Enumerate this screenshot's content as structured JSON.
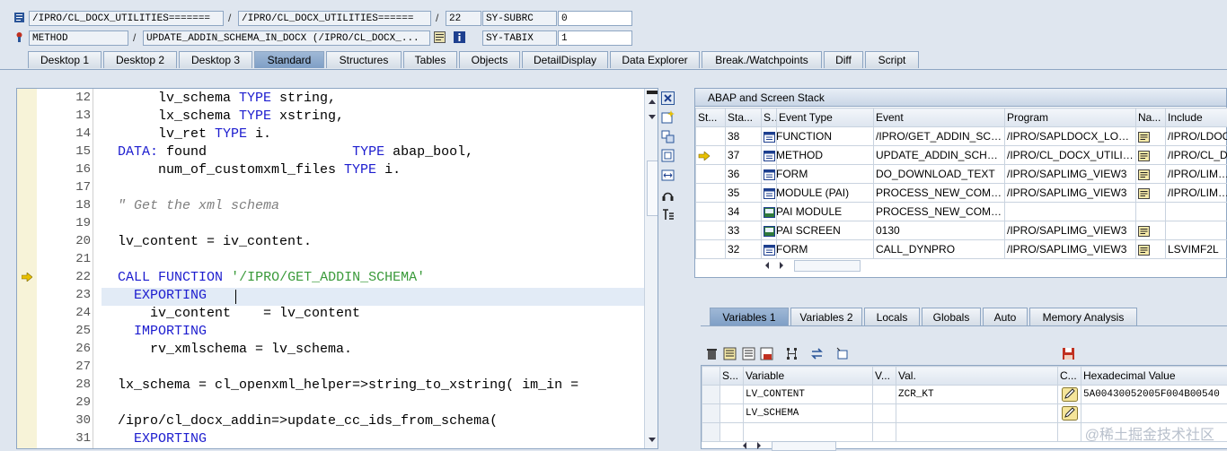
{
  "header": {
    "row1": {
      "program": "/IPRO/CL_DOCX_UTILITIES=======",
      "include": "/IPRO/CL_DOCX_UTILITIES======",
      "line": "22",
      "sy_label": "SY-SUBRC",
      "sy_value": "0"
    },
    "row2": {
      "event_type": "METHOD",
      "event": "UPDATE_ADDIN_SCHEMA_IN_DOCX (/IPRO/CL_DOCX_...",
      "sy_label": "SY-TABIX",
      "sy_value": "1"
    },
    "separator": "/"
  },
  "tabs": [
    {
      "label": "Desktop 1"
    },
    {
      "label": "Desktop 2"
    },
    {
      "label": "Desktop 3"
    },
    {
      "label": "Standard"
    },
    {
      "label": "Structures"
    },
    {
      "label": "Tables"
    },
    {
      "label": "Objects"
    },
    {
      "label": "DetailDisplay"
    },
    {
      "label": "Data Explorer"
    },
    {
      "label": "Break./Watchpoints"
    },
    {
      "label": "Diff"
    },
    {
      "label": "Script"
    }
  ],
  "code": {
    "lines": [
      {
        "n": "12",
        "parts": [
          [
            "",
            "       lv_schema "
          ],
          [
            "kw",
            "TYPE"
          ],
          [
            "",
            " string,"
          ]
        ]
      },
      {
        "n": "13",
        "parts": [
          [
            "",
            "       lx_schema "
          ],
          [
            "kw",
            "TYPE"
          ],
          [
            "",
            " xstring,"
          ]
        ]
      },
      {
        "n": "14",
        "parts": [
          [
            "",
            "       lv_ret "
          ],
          [
            "kw",
            "TYPE"
          ],
          [
            "",
            " i."
          ]
        ]
      },
      {
        "n": "15",
        "parts": [
          [
            "",
            "  "
          ],
          [
            "kw",
            "DATA:"
          ],
          [
            "",
            " found                  "
          ],
          [
            "kw",
            "TYPE"
          ],
          [
            "",
            " abap_bool,"
          ]
        ]
      },
      {
        "n": "16",
        "parts": [
          [
            "",
            "       num_of_customxml_files "
          ],
          [
            "kw",
            "TYPE"
          ],
          [
            "",
            " i."
          ]
        ]
      },
      {
        "n": "17",
        "parts": [
          [
            "",
            ""
          ]
        ]
      },
      {
        "n": "18",
        "parts": [
          [
            "",
            "  "
          ],
          [
            "cm",
            "\" Get the xml schema"
          ]
        ]
      },
      {
        "n": "19",
        "parts": [
          [
            "",
            ""
          ]
        ]
      },
      {
        "n": "20",
        "parts": [
          [
            "",
            "  lv_content = iv_content."
          ]
        ]
      },
      {
        "n": "21",
        "parts": [
          [
            "",
            ""
          ]
        ]
      },
      {
        "n": "22",
        "parts": [
          [
            "",
            "  "
          ],
          [
            "kw",
            "CALL FUNCTION"
          ],
          [
            "",
            " "
          ],
          [
            "str",
            "'/IPRO/GET_ADDIN_SCHEMA'"
          ]
        ]
      },
      {
        "n": "23",
        "parts": [
          [
            "",
            "    "
          ],
          [
            "kw",
            "EXPORTING"
          ]
        ]
      },
      {
        "n": "24",
        "parts": [
          [
            "",
            "      iv_content    = lv_content"
          ]
        ]
      },
      {
        "n": "25",
        "parts": [
          [
            "",
            "    "
          ],
          [
            "kw",
            "IMPORTING"
          ]
        ]
      },
      {
        "n": "26",
        "parts": [
          [
            "",
            "      rv_xmlschema = lv_schema."
          ]
        ]
      },
      {
        "n": "27",
        "parts": [
          [
            "",
            ""
          ]
        ]
      },
      {
        "n": "28",
        "parts": [
          [
            "",
            "  lx_schema = cl_openxml_helper=>string_to_xstring( im_in ="
          ]
        ]
      },
      {
        "n": "29",
        "parts": [
          [
            "",
            ""
          ]
        ]
      },
      {
        "n": "30",
        "parts": [
          [
            "",
            "  /ipro/cl_docx_addin=>update_cc_ids_from_schema("
          ]
        ]
      },
      {
        "n": "31",
        "parts": [
          [
            "",
            "    "
          ],
          [
            "kw",
            "EXPORTING"
          ]
        ]
      }
    ]
  },
  "stack": {
    "title": "ABAP and Screen Stack",
    "columns": [
      "St...",
      "Sta...",
      "S...",
      "Event Type",
      "Event",
      "Program",
      "Na...",
      "Include"
    ],
    "rows": [
      {
        "level": "38",
        "type": "FUNCTION",
        "event": "/IPRO/GET_ADDIN_SCH...",
        "program": "/IPRO/SAPLDOCX_LOGIC",
        "nav": true,
        "include": "/IPRO/LDOC"
      },
      {
        "level": "37",
        "type": "METHOD",
        "event": "UPDATE_ADDIN_SCHEM...",
        "program": "/IPRO/CL_DOCX_UTILITI...",
        "nav": true,
        "include": "/IPRO/CL_D",
        "current": true
      },
      {
        "level": "36",
        "type": "FORM",
        "event": "DO_DOWNLOAD_TEXT",
        "program": "/IPRO/SAPLIMG_VIEW3",
        "nav": true,
        "include": "/IPRO/LIMG_"
      },
      {
        "level": "35",
        "type": "MODULE (PAI)",
        "event": "PROCESS_NEW_COMMA...",
        "program": "/IPRO/SAPLIMG_VIEW3",
        "nav": true,
        "include": "/IPRO/LIMG_"
      },
      {
        "level": "34",
        "type": "PAI MODULE",
        "event": "PROCESS_NEW_COMMA...",
        "program": "",
        "nav": false,
        "include": ""
      },
      {
        "level": "33",
        "type": "PAI SCREEN",
        "event": "0130",
        "program": "/IPRO/SAPLIMG_VIEW3",
        "nav": true,
        "include": ""
      },
      {
        "level": "32",
        "type": "FORM",
        "event": "CALL_DYNPRO",
        "program": "/IPRO/SAPLIMG_VIEW3",
        "nav": true,
        "include": "LSVIMF2L"
      }
    ]
  },
  "var_tabs": [
    {
      "label": "Variables 1"
    },
    {
      "label": "Variables 2"
    },
    {
      "label": "Locals"
    },
    {
      "label": "Globals"
    },
    {
      "label": "Auto"
    },
    {
      "label": "Memory Analysis"
    }
  ],
  "variables": {
    "columns": [
      "S...",
      "Variable",
      "V...",
      "Val.",
      "C...",
      "Hexadecimal Value"
    ],
    "rows": [
      {
        "name": "LV_CONTENT",
        "val": "ZCR_KT",
        "hex": "5A00430052005F004B00540"
      },
      {
        "name": "LV_SCHEMA",
        "val": "",
        "hex": ""
      }
    ]
  },
  "colors": {
    "accent": "#7f9fc6",
    "keyword": "#1d1dcf",
    "string": "#3a9a3a",
    "comment": "#808080"
  },
  "watermark": "@稀土掘金技术社区"
}
